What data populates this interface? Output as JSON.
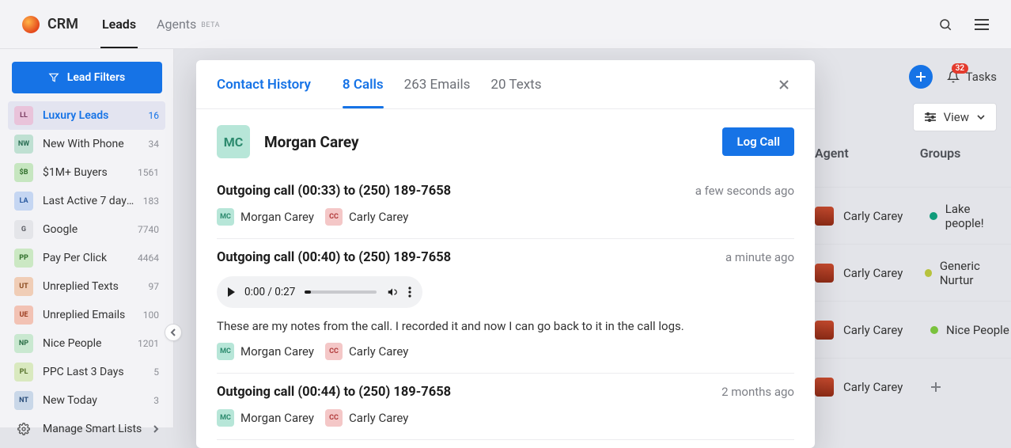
{
  "brand": "CRM",
  "nav": {
    "leads": "Leads",
    "agents": "Agents",
    "beta": "BETA"
  },
  "topright": {
    "tasks": "Tasks",
    "tasks_badge": "32"
  },
  "sidebar": {
    "filters_btn": "Lead Filters",
    "items": [
      {
        "abbr": "LL",
        "name": "Luxury Leads",
        "count": "16",
        "bg": "#e9c3da",
        "fg": "#7a3d62"
      },
      {
        "abbr": "NW",
        "name": "New With Phone",
        "count": "34",
        "bg": "#bfe0d2",
        "fg": "#2a6e54"
      },
      {
        "abbr": "$B",
        "name": "$1M+ Buyers",
        "count": "1561",
        "bg": "#c6e6c0",
        "fg": "#2f6e2a"
      },
      {
        "abbr": "LA",
        "name": "Last Active 7 days...",
        "count": "183",
        "bg": "#c5d6f2",
        "fg": "#2a5aa0"
      },
      {
        "abbr": "G",
        "name": "Google",
        "count": "7740",
        "bg": "#e4e5e9",
        "fg": "#5a5c63"
      },
      {
        "abbr": "PP",
        "name": "Pay Per Click",
        "count": "4464",
        "bg": "#cbe8c3",
        "fg": "#2f6e2a"
      },
      {
        "abbr": "UT",
        "name": "Unreplied Texts",
        "count": "97",
        "bg": "#f0cdb6",
        "fg": "#8a4a1f"
      },
      {
        "abbr": "UE",
        "name": "Unreplied Emails",
        "count": "100",
        "bg": "#f2c2b4",
        "fg": "#9a3b1e"
      },
      {
        "abbr": "NP",
        "name": "Nice People",
        "count": "1201",
        "bg": "#c9e8d0",
        "fg": "#2a6e46"
      },
      {
        "abbr": "PL",
        "name": "PPC Last 3 Days",
        "count": "5",
        "bg": "#d9e9bf",
        "fg": "#56712a"
      },
      {
        "abbr": "NT",
        "name": "New Today",
        "count": "3",
        "bg": "#c9d7e8",
        "fg": "#2a4e7a"
      }
    ],
    "manage": "Manage Smart Lists"
  },
  "view_btn": "View",
  "table": {
    "agent_h": "Agent",
    "groups_h": "Groups",
    "rows": [
      {
        "agent": "Carly Carey",
        "group": "Lake people!",
        "color": "#0f9b7a"
      },
      {
        "agent": "Carly Carey",
        "group": "Generic Nurtur",
        "color": "#b7c23d"
      },
      {
        "agent": "Carly Carey",
        "group": "Nice People",
        "color": "#7ac23d"
      },
      {
        "agent": "Carly Carey",
        "group": "",
        "color": ""
      }
    ]
  },
  "modal": {
    "title": "Contact History",
    "tabs": {
      "calls": "8 Calls",
      "emails": "263 Emails",
      "texts": "20 Texts"
    },
    "lead": {
      "initials": "MC",
      "name": "Morgan Carey"
    },
    "log_btn": "Log Call",
    "player_time": "0:00 / 0:27",
    "entries": [
      {
        "title": "Outgoing call (00:33) to (250) 189-7658",
        "time": "a few seconds ago",
        "people": [
          {
            "i": "MC",
            "n": "Morgan Carey",
            "bg": "#b7e6d8",
            "fg": "#2c8a6e"
          },
          {
            "i": "CC",
            "n": "Carly Carey",
            "bg": "#f4c7c7",
            "fg": "#b23d3d"
          }
        ]
      },
      {
        "title": "Outgoing call (00:40) to (250) 189-7658",
        "time": "a minute ago",
        "note": "These are my notes from the call. I recorded it and now I can go back to it in the call logs.",
        "player": true,
        "people": [
          {
            "i": "MC",
            "n": "Morgan Carey",
            "bg": "#b7e6d8",
            "fg": "#2c8a6e"
          },
          {
            "i": "CC",
            "n": "Carly Carey",
            "bg": "#f4c7c7",
            "fg": "#b23d3d"
          }
        ]
      },
      {
        "title": "Outgoing call (00:44) to (250) 189-7658",
        "time": "2 months ago",
        "people": [
          {
            "i": "MC",
            "n": "Morgan Carey",
            "bg": "#b7e6d8",
            "fg": "#2c8a6e"
          },
          {
            "i": "CC",
            "n": "Carly Carey",
            "bg": "#f4c7c7",
            "fg": "#b23d3d"
          }
        ]
      }
    ]
  }
}
